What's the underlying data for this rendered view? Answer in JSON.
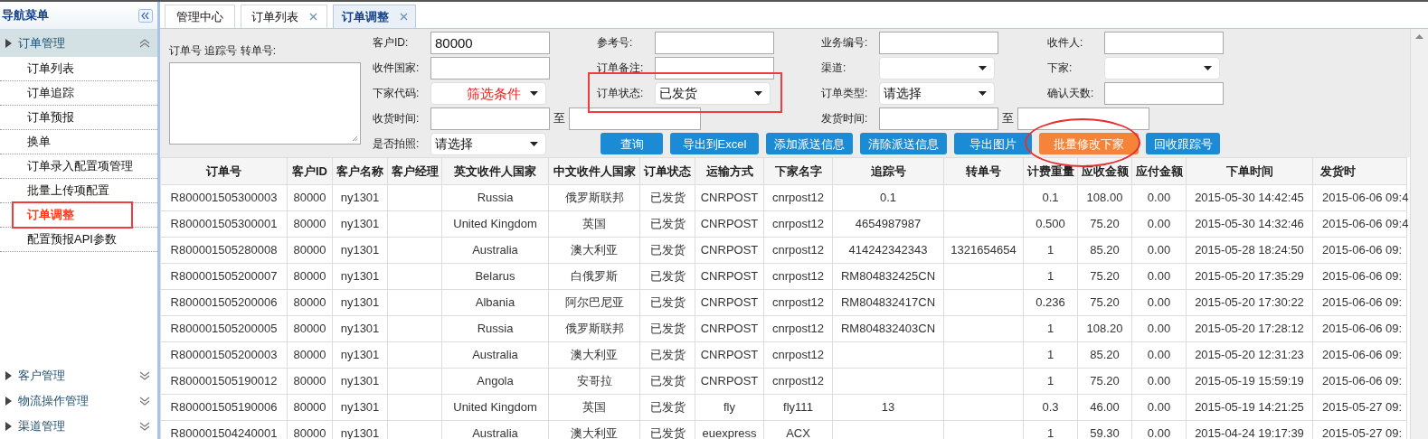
{
  "sidebar": {
    "title": "导航菜单",
    "sections": [
      {
        "label": "订单管理",
        "expanded": true,
        "items": [
          {
            "label": "订单列表",
            "selected": false
          },
          {
            "label": "订单追踪",
            "selected": false
          },
          {
            "label": "订单预报",
            "selected": false
          },
          {
            "label": "换单",
            "selected": false
          },
          {
            "label": "订单录入配置项管理",
            "selected": false
          },
          {
            "label": "批量上传项配置",
            "selected": false
          },
          {
            "label": "订单调整",
            "selected": true
          },
          {
            "label": "配置预报API参数",
            "selected": false
          }
        ]
      },
      {
        "label": "客户管理",
        "expanded": false
      },
      {
        "label": "物流操作管理",
        "expanded": false
      },
      {
        "label": "渠道管理",
        "expanded": false
      }
    ]
  },
  "tabs": [
    {
      "label": "管理中心",
      "closable": false,
      "selected": false
    },
    {
      "label": "订单列表",
      "closable": true,
      "selected": false
    },
    {
      "label": "订单调整",
      "closable": true,
      "selected": true
    }
  ],
  "filters": {
    "numbers_label": "订单号 追踪号 转单号:",
    "rows": [
      [
        {
          "kind": "text",
          "label": "客户ID:",
          "value": "80000"
        },
        {
          "kind": "text",
          "label": "参考号:"
        },
        {
          "kind": "text",
          "label": "业务编号:"
        },
        {
          "kind": "text",
          "label": "收件人:"
        }
      ],
      [
        {
          "kind": "text",
          "label": "收件国家:"
        },
        {
          "kind": "text",
          "label": "订单备注:"
        },
        {
          "kind": "select",
          "label": "渠道:"
        },
        {
          "kind": "select",
          "label": "下家:"
        }
      ],
      [
        {
          "kind": "select",
          "label": "下家代码:",
          "note": "筛选条件"
        },
        {
          "kind": "select",
          "label": "订单状态:",
          "value": "已发货",
          "highlighted": true
        },
        {
          "kind": "select",
          "label": "订单类型:",
          "value": "请选择"
        },
        {
          "kind": "text",
          "label": "确认天数:"
        }
      ],
      [
        {
          "kind": "daterange",
          "label": "收货时间:",
          "separator": "至"
        },
        "",
        {
          "kind": "daterange",
          "label": "发货时间:",
          "separator": "至"
        }
      ],
      [
        {
          "kind": "select",
          "label": "是否拍照:",
          "value": "请选择"
        }
      ]
    ],
    "buttons": [
      {
        "label": "查询",
        "color": "#1b8bd6"
      },
      {
        "label": "导出到Excel",
        "color": "#1b8bd6"
      },
      {
        "label": "添加派送信息",
        "color": "#1b8bd6"
      },
      {
        "label": "清除派送信息",
        "color": "#1b8bd6"
      },
      {
        "label": "导出图片",
        "color": "#1b8bd6"
      },
      {
        "label": "批量修改下家",
        "color": "#f5843a",
        "highlighted": true
      },
      {
        "label": "回收跟踪号",
        "color": "#1b8bd6"
      }
    ]
  },
  "table": {
    "columns": [
      "订单号",
      "客户ID",
      "客户名称",
      "客户经理",
      "英文收件人国家",
      "中文收件人国家",
      "订单状态",
      "运输方式",
      "下家名字",
      "追踪号",
      "转单号",
      "计费重量",
      "应收金额",
      "应付金额",
      "下单时间",
      "发货时"
    ],
    "rows": [
      [
        "R800001505300003",
        "80000",
        "ny1301",
        null,
        "Russia",
        "俄罗斯联邦",
        "已发货",
        "CNRPOST",
        "cnrpost12",
        "0.1",
        null,
        "0.1",
        "108.00",
        "0.00",
        "2015-05-30 14:42:45",
        "2015-06-06 09:4"
      ],
      [
        "R800001505300001",
        "80000",
        "ny1301",
        null,
        "United Kingdom",
        "英国",
        "已发货",
        "CNRPOST",
        "cnrpost12",
        "4654987987",
        null,
        "0.500",
        "75.20",
        "0.00",
        "2015-05-30 14:32:46",
        "2015-06-06 09:4"
      ],
      [
        "R800001505280008",
        "80000",
        "ny1301",
        null,
        "Australia",
        "澳大利亚",
        "已发货",
        "CNRPOST",
        "cnrpost12",
        "414242342343",
        "1321654654",
        "1",
        "85.20",
        "0.00",
        "2015-05-28 18:24:50",
        "2015-06-06 09:"
      ],
      [
        "R800001505200007",
        "80000",
        "ny1301",
        null,
        "Belarus",
        "白俄罗斯",
        "已发货",
        "CNRPOST",
        "cnrpost12",
        "RM804832425CN",
        null,
        "1",
        "75.20",
        "0.00",
        "2015-05-20 17:35:29",
        "2015-06-06 09:"
      ],
      [
        "R800001505200006",
        "80000",
        "ny1301",
        null,
        "Albania",
        "阿尔巴尼亚",
        "已发货",
        "CNRPOST",
        "cnrpost12",
        "RM804832417CN",
        null,
        "0.236",
        "75.20",
        "0.00",
        "2015-05-20 17:30:22",
        "2015-06-06 09:"
      ],
      [
        "R800001505200005",
        "80000",
        "ny1301",
        null,
        "Russia",
        "俄罗斯联邦",
        "已发货",
        "CNRPOST",
        "cnrpost12",
        "RM804832403CN",
        null,
        "1",
        "108.20",
        "0.00",
        "2015-05-20 17:28:12",
        "2015-06-06 09:"
      ],
      [
        "R800001505200003",
        "80000",
        "ny1301",
        null,
        "Australia",
        "澳大利亚",
        "已发货",
        "CNRPOST",
        "cnrpost12",
        null,
        null,
        "1",
        "85.20",
        "0.00",
        "2015-05-20 12:31:23",
        "2015-06-06 09:"
      ],
      [
        "R800001505190012",
        "80000",
        "ny1301",
        null,
        "Angola",
        "安哥拉",
        "已发货",
        "CNRPOST",
        "cnrpost12",
        null,
        null,
        "1",
        "75.20",
        "0.00",
        "2015-05-19 15:59:19",
        "2015-06-06 09:"
      ],
      [
        "R800001505190006",
        "80000",
        "ny1301",
        null,
        "United Kingdom",
        "英国",
        "已发货",
        "fly",
        "fly111",
        "13",
        null,
        "0.3",
        "46.00",
        "0.00",
        "2015-05-19 14:21:25",
        "2015-05-27 09:"
      ],
      [
        "R800001504240001",
        "80000",
        "ny1301",
        null,
        "Australia",
        "澳大利亚",
        "已发货",
        "euexpress",
        "ACX",
        null,
        null,
        "1",
        "59.30",
        "0.00",
        "2015-04-24 19:17:39",
        "2015-05-27 09:"
      ]
    ]
  }
}
